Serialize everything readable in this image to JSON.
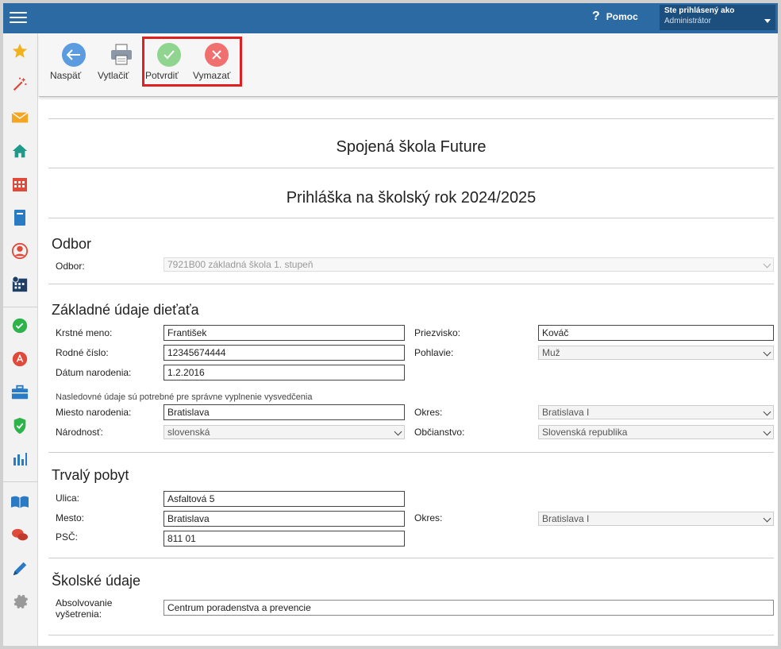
{
  "header": {
    "help_label": "Pomoc",
    "help_symbol": "?",
    "user_line1": "Ste prihlásený ako",
    "user_line2": "Administrátor"
  },
  "toolbar": {
    "back_label": "Naspäť",
    "print_label": "Vytlačiť",
    "confirm_label": "Potvrdiť",
    "delete_label": "Vymazať"
  },
  "form": {
    "school_name": "Spojená škola Future",
    "form_title": "Prihláška na školský rok 2024/2025",
    "odbor": {
      "section_title": "Odbor",
      "label": "Odbor:",
      "value": "7921B00 základná škola 1. stupeň"
    },
    "child": {
      "section_title": "Základné údaje dieťaťa",
      "first_name_label": "Krstné meno:",
      "first_name": "František",
      "surname_label": "Priezvisko:",
      "surname": "Kováč",
      "birth_number_label": "Rodné číslo:",
      "birth_number": "12345674444",
      "gender_label": "Pohlavie:",
      "gender": "Muž",
      "birth_date_label": "Dátum narodenia:",
      "birth_date": "1.2.2016",
      "note": "Nasledovné údaje sú potrebné pre správne vyplnenie vysvedčenia",
      "birth_place_label": "Miesto narodenia:",
      "birth_place": "Bratislava",
      "district_label": "Okres:",
      "district": "Bratislava I",
      "nationality_label": "Národnosť:",
      "nationality": "slovenská",
      "citizenship_label": "Občianstvo:",
      "citizenship": "Slovenská republika"
    },
    "residence": {
      "section_title": "Trvalý pobyt",
      "street_label": "Ulica:",
      "street": "Asfaltová 5",
      "city_label": "Mesto:",
      "city": "Bratislava",
      "district_label": "Okres:",
      "district": "Bratislava I",
      "zip_label": "PSČ:",
      "zip": "811 01"
    },
    "school": {
      "section_title": "Školské údaje",
      "exam_label_1": "Absolvovanie",
      "exam_label_2": "vyšetrenia:",
      "exam": "Centrum poradenstva a prevencie"
    }
  },
  "colors": {
    "topbar": "#2b6aa3",
    "back": "#5b9be0",
    "confirm": "#8fd48f",
    "delete": "#f07070",
    "highlight": "#e02020"
  },
  "sidebar_icons": [
    "star-icon",
    "magic-wand-icon",
    "mail-icon",
    "home-icon",
    "calendar-grid-icon",
    "notebook-icon",
    "user-profile-icon",
    "schedule-icon",
    "check-circle-icon",
    "acrobat-icon",
    "briefcase-icon",
    "shield-check-icon",
    "bar-chart-icon",
    "open-book-icon",
    "chat-bubbles-icon",
    "pen-icon",
    "gear-icon"
  ]
}
